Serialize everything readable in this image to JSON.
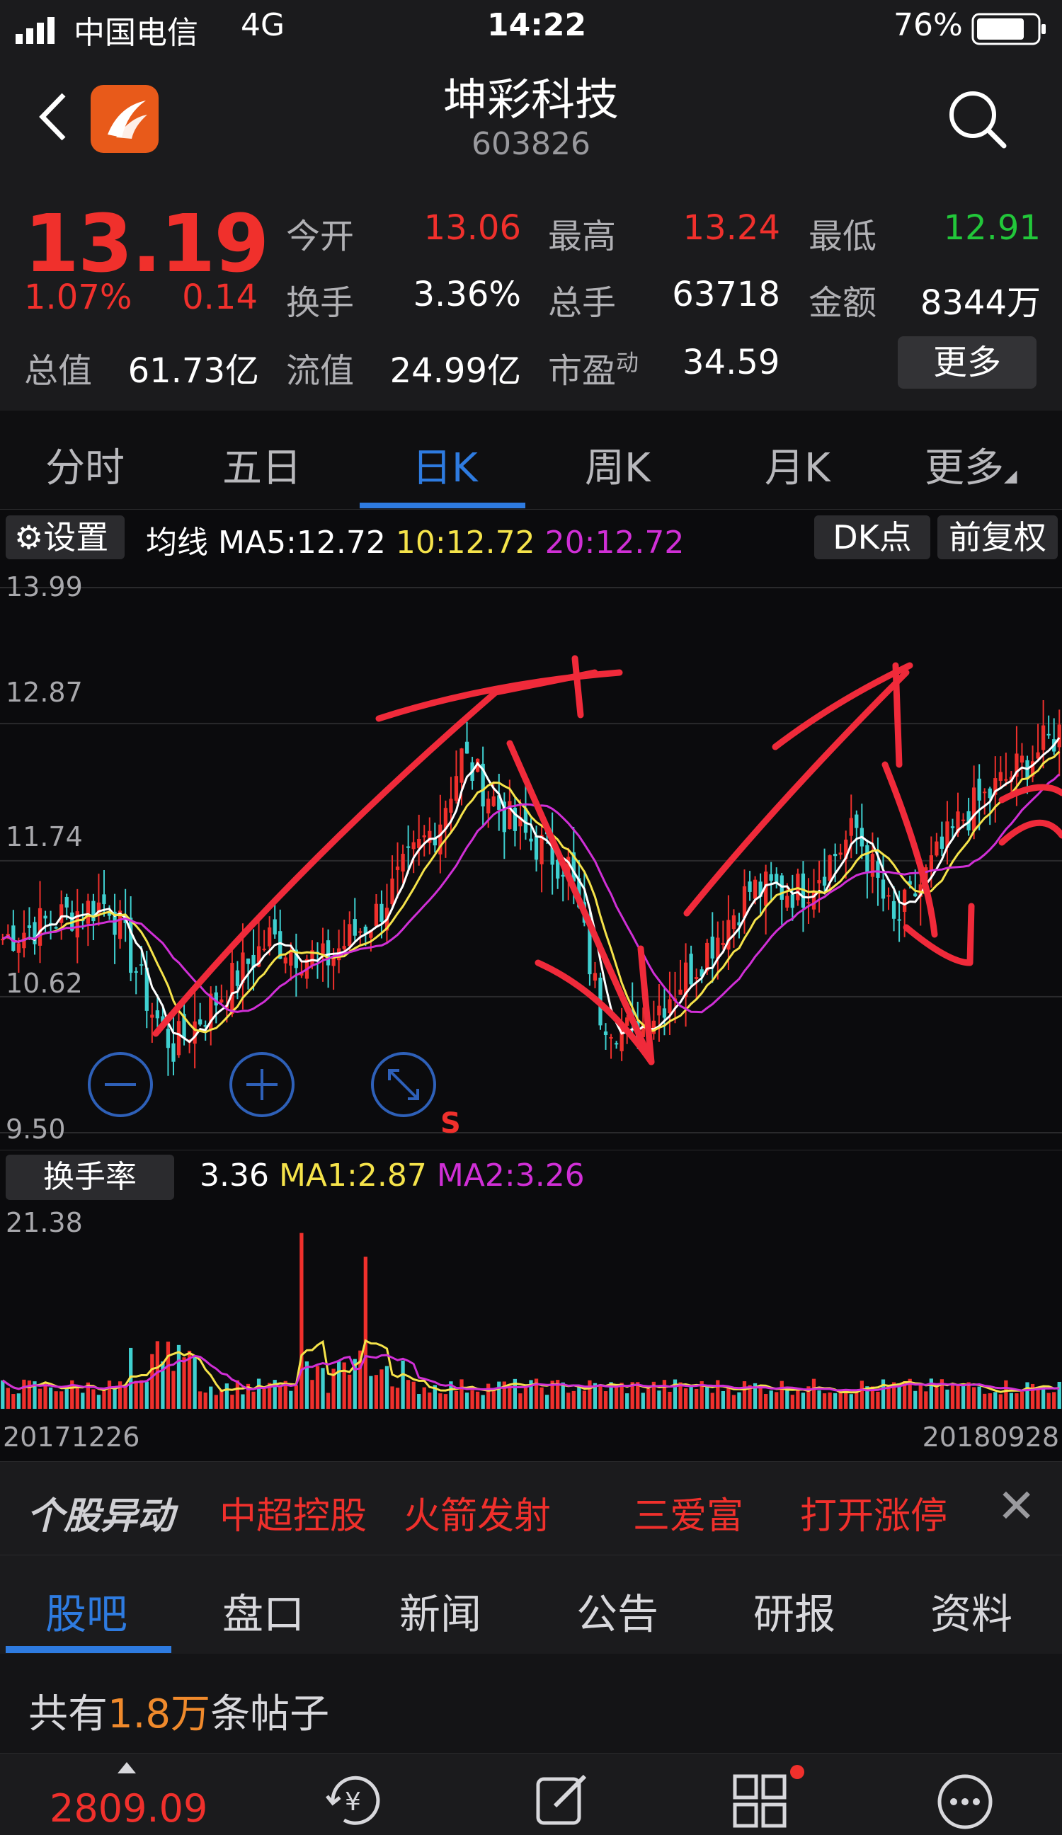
{
  "status_bar": {
    "carrier": "中国电信",
    "network": "4G",
    "time": "14:22",
    "battery": "76%"
  },
  "header": {
    "title": "坤彩科技",
    "code": "603826"
  },
  "quote": {
    "price": "13.19",
    "change_pct": "1.07%",
    "change": "0.14",
    "open_label": "今开",
    "open": "13.06",
    "high_label": "最高",
    "high": "13.24",
    "low_label": "最低",
    "low": "12.91",
    "turnover_label": "换手",
    "turnover": "3.36%",
    "volume_label": "总手",
    "volume": "63718",
    "amount_label": "金额",
    "amount": "8344万",
    "mktcap_label": "总值",
    "mktcap": "61.73亿",
    "float_label": "流值",
    "float_cap": "24.99亿",
    "pe_label": "市盈",
    "pe_sup": "动",
    "pe": "34.59",
    "more_button": "更多"
  },
  "chart_tabs": [
    "分时",
    "五日",
    "日K",
    "周K",
    "月K",
    "更多"
  ],
  "ma_bar": {
    "settings": "设置",
    "label": "均线",
    "ma5": "MA5:12.72",
    "ma10": "10:12.72",
    "ma20": "20:12.72",
    "dk_button": "DK点",
    "adjust_button": "前复权"
  },
  "price_axis": [
    "13.99",
    "12.87",
    "11.74",
    "10.62",
    "9.50"
  ],
  "kchart_marker": "S",
  "turnover_bar": {
    "button": "换手率",
    "value": "3.36",
    "ma1": "MA1:2.87",
    "ma2": "MA2:3.26",
    "max": "21.38"
  },
  "dates": {
    "start": "20171226",
    "end": "20180928"
  },
  "movers": {
    "title": "个股异动",
    "items": [
      "中超控股",
      "火箭发射",
      "三爱富",
      "打开涨停"
    ]
  },
  "bottom_tabs": [
    "股吧",
    "盘口",
    "新闻",
    "公告",
    "研报",
    "资料"
  ],
  "posts": {
    "prefix": "共有",
    "count": "1.8万",
    "suffix": "条帖子"
  },
  "bottom_nav": {
    "index": "2809.09"
  },
  "colors": {
    "up": "#f0302c",
    "down": "#3fd0d0",
    "ma5": "#ffffff",
    "ma10": "#f5e34a",
    "ma20": "#d02fd6",
    "accent": "#2e7be0"
  },
  "chart_data": {
    "type": "candlestick",
    "title": "",
    "ylim": [
      9.5,
      13.99
    ],
    "yticks": [
      13.99,
      12.87,
      11.74,
      10.62,
      9.5
    ],
    "x_range": [
      "20171226",
      "20180928"
    ],
    "ma5_last": 12.72,
    "ma10_last": 12.72,
    "ma20_last": 12.72,
    "turnover_last": 3.36,
    "turnover_ma1": 2.87,
    "turnover_ma2": 3.26,
    "turnover_max": 21.38
  }
}
